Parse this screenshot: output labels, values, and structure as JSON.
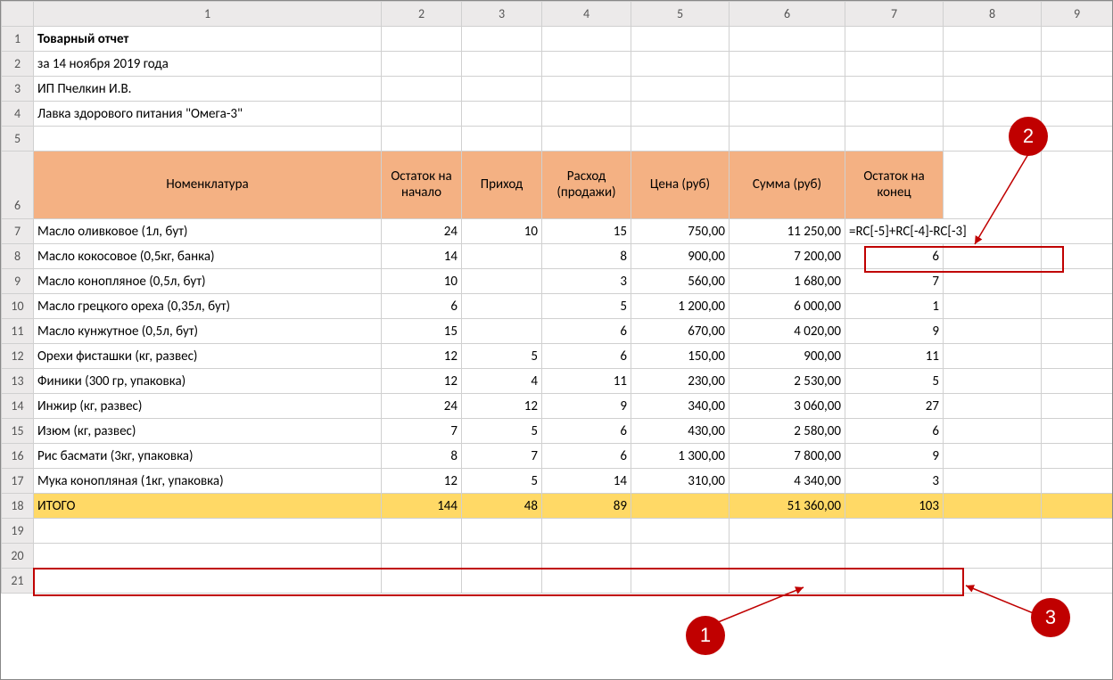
{
  "colHeaders": [
    "1",
    "2",
    "3",
    "4",
    "5",
    "6",
    "7",
    "8",
    "9"
  ],
  "title": "Товарный отчет",
  "subtitle1": "за 14 ноября 2019 года",
  "subtitle2": "ИП Пчелкин И.В.",
  "subtitle3": "Лавка здорового питания \"Омега-3\"",
  "headers": {
    "c1": "Номенклатура",
    "c2": "Остаток на начало",
    "c3": "Приход",
    "c4": "Расход (продажи)",
    "c5": "Цена (руб)",
    "c6": "Сумма (руб)",
    "c7": "Остаток на конец"
  },
  "formula": "=RC[-5]+RC[-4]-RC[-3]",
  "rows": [
    {
      "n": "Масло оливковое (1л, бут)",
      "b": "24",
      "in": "10",
      "out": "15",
      "price": "750,00",
      "sum": "11 250,00",
      "e": ""
    },
    {
      "n": "Масло кокосовое (0,5кг, банка)",
      "b": "14",
      "in": "",
      "out": "8",
      "price": "900,00",
      "sum": "7 200,00",
      "e": "6"
    },
    {
      "n": "Масло конопляное (0,5л, бут)",
      "b": "10",
      "in": "",
      "out": "3",
      "price": "560,00",
      "sum": "1 680,00",
      "e": "7"
    },
    {
      "n": "Масло грецкого ореха (0,35л, бут)",
      "b": "6",
      "in": "",
      "out": "5",
      "price": "1 200,00",
      "sum": "6 000,00",
      "e": "1"
    },
    {
      "n": "Масло кунжутное (0,5л, бут)",
      "b": "15",
      "in": "",
      "out": "6",
      "price": "670,00",
      "sum": "4 020,00",
      "e": "9"
    },
    {
      "n": "Орехи фисташки (кг, развес)",
      "b": "12",
      "in": "5",
      "out": "6",
      "price": "150,00",
      "sum": "900,00",
      "e": "11"
    },
    {
      "n": "Финики (300 гр, упаковка)",
      "b": "12",
      "in": "4",
      "out": "11",
      "price": "230,00",
      "sum": "2 530,00",
      "e": "5"
    },
    {
      "n": "Инжир (кг, развес)",
      "b": "24",
      "in": "12",
      "out": "9",
      "price": "340,00",
      "sum": "3 060,00",
      "e": "27"
    },
    {
      "n": "Изюм (кг, развес)",
      "b": "7",
      "in": "5",
      "out": "6",
      "price": "430,00",
      "sum": "2 580,00",
      "e": "6"
    },
    {
      "n": "Рис басмати (3кг, упаковка)",
      "b": "8",
      "in": "7",
      "out": "6",
      "price": "1 300,00",
      "sum": "7 800,00",
      "e": "9"
    },
    {
      "n": "Мука конопляная (1кг, упаковка)",
      "b": "12",
      "in": "5",
      "out": "14",
      "price": "310,00",
      "sum": "4 340,00",
      "e": "3"
    }
  ],
  "total": {
    "n": "ИТОГО",
    "b": "144",
    "in": "48",
    "out": "89",
    "price": "",
    "sum": "51 360,00",
    "e": "103"
  },
  "ann": {
    "a1": "1",
    "a2": "2",
    "a3": "3"
  }
}
